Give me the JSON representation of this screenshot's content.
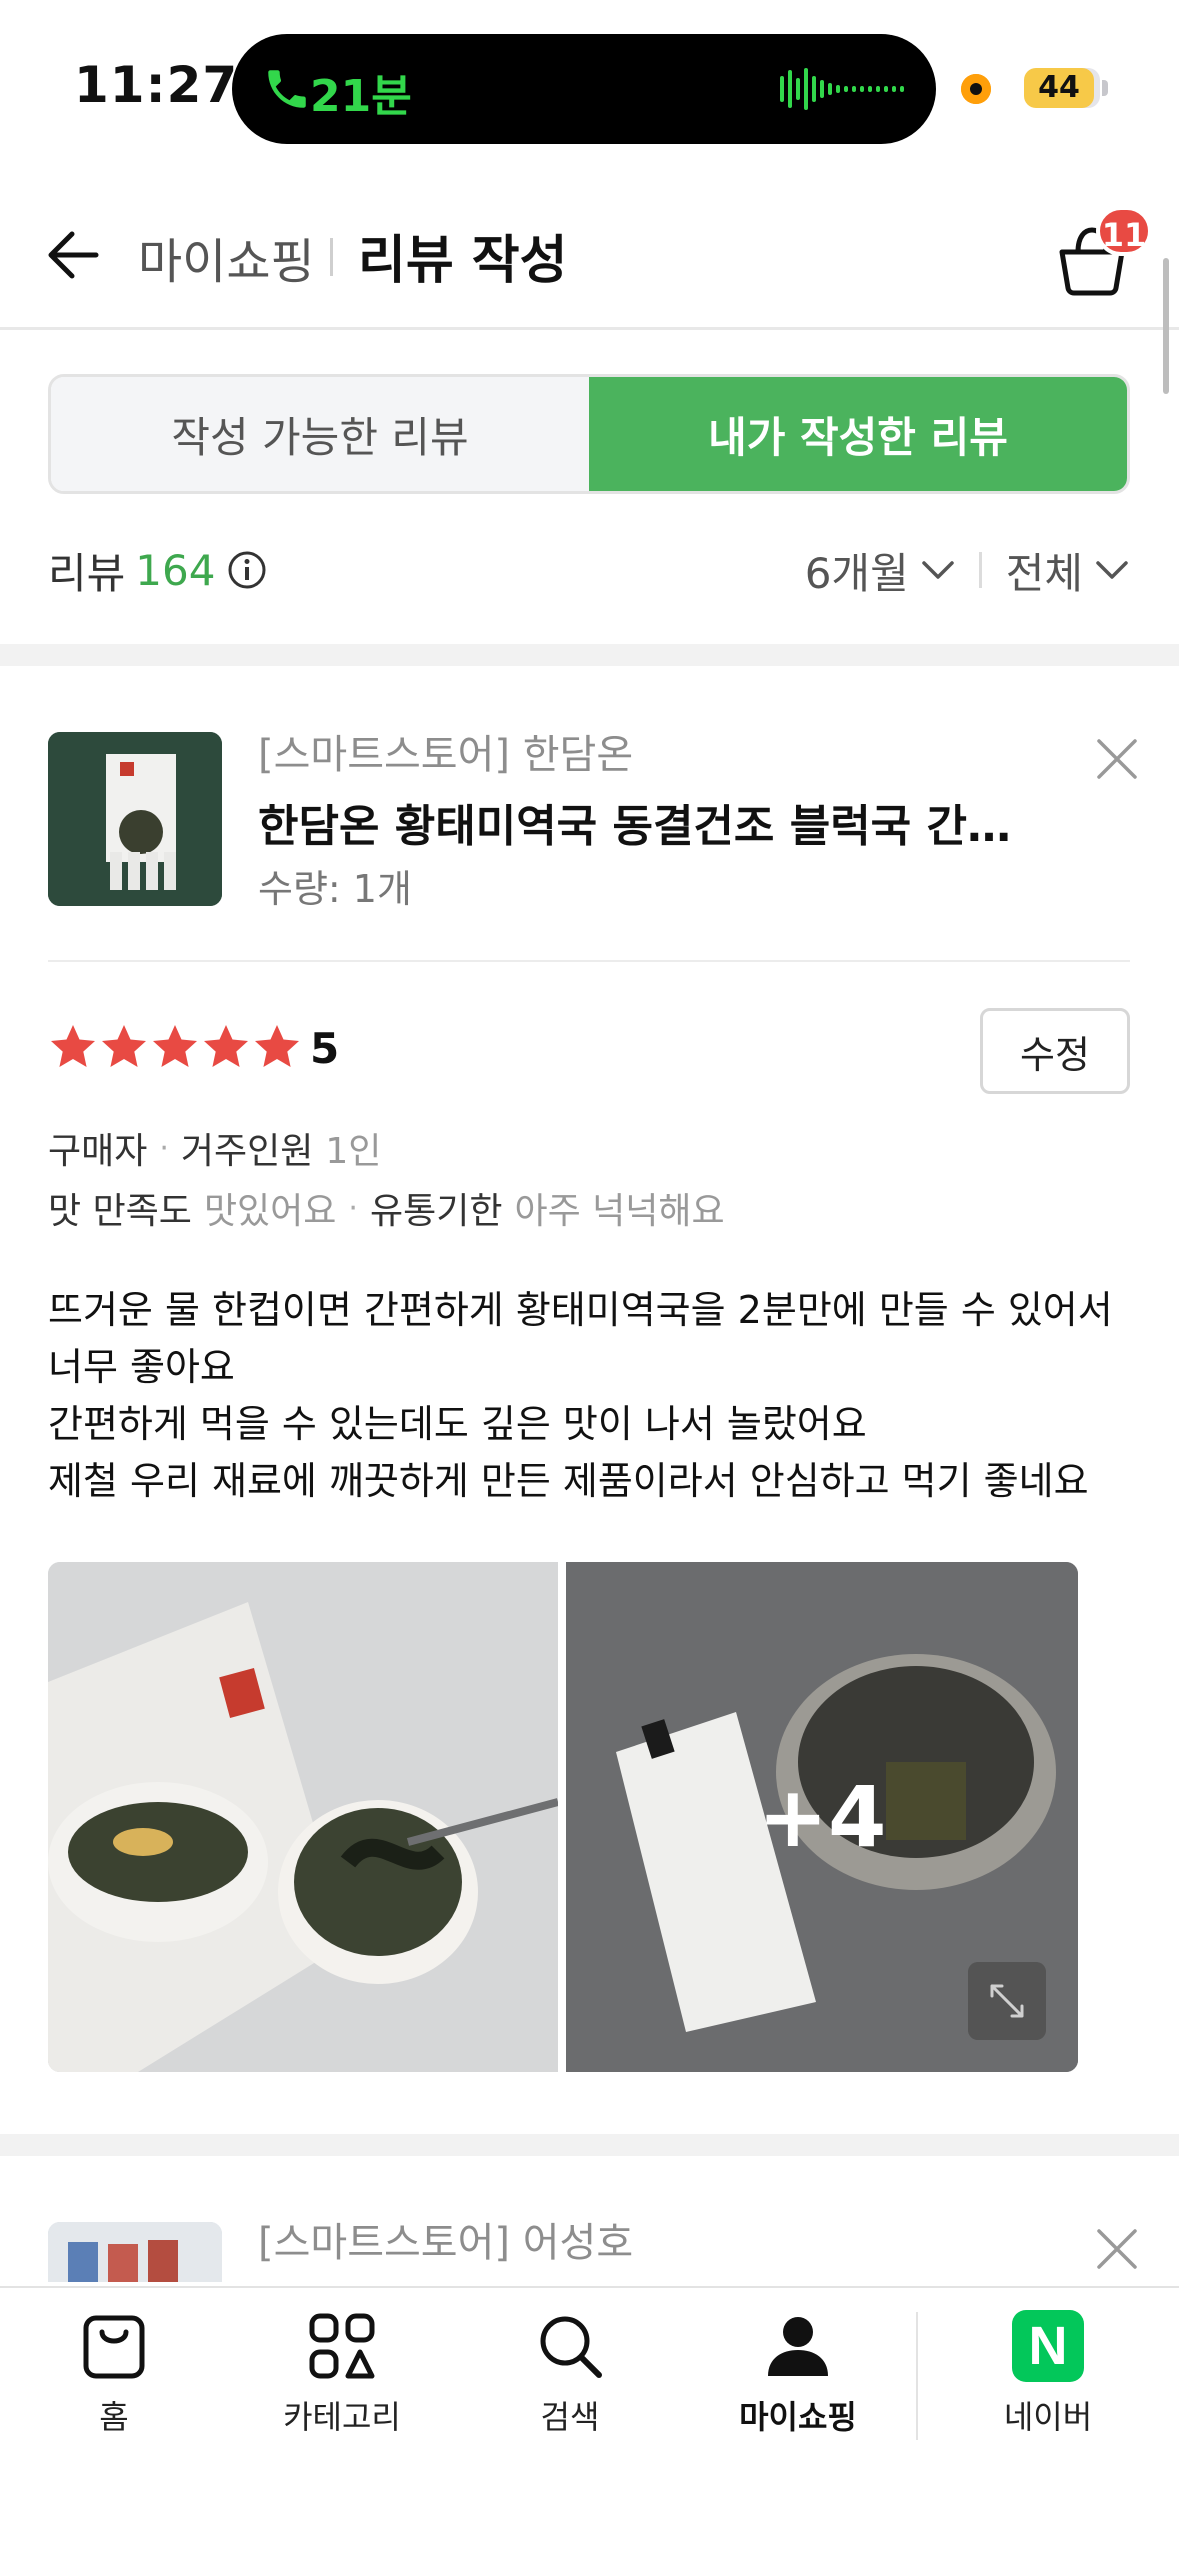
{
  "status_bar": {
    "time": "11:27",
    "call_duration": "21분",
    "battery": "44"
  },
  "header": {
    "parent": "마이쇼핑",
    "title": "리뷰 작성",
    "cart_count": "11"
  },
  "tabs": [
    {
      "label": "작성 가능한 리뷰",
      "active": false
    },
    {
      "label": "내가 작성한 리뷰",
      "active": true
    }
  ],
  "review_summary": {
    "label": "리뷰",
    "count": "164",
    "period_filter": "6개월",
    "type_filter": "전체"
  },
  "review": {
    "store": "[스마트스토어] 한담온",
    "product_name": "한담온 황태미역국 동결건조 블럭국 간편...",
    "quantity": "수량: 1개",
    "rating": "5",
    "edit_label": "수정",
    "meta1": {
      "buyer": "구매자",
      "household_key": "거주인원",
      "household_val": "1인"
    },
    "meta2": {
      "taste_key": "맛 만족도",
      "taste_val": "맛있어요",
      "expiry_key": "유통기한",
      "expiry_val": "아주 넉넉해요"
    },
    "text_lines": [
      "뜨거운 물 한컵이면 간편하게 황태미역국을 2분만에 만들 수 있어서",
      "너무 좋아요",
      "간편하게 먹을 수 있는데도 깊은 맛이 나서 놀랐어요",
      "제철 우리 재료에 깨끗하게 만든 제품이라서 안심하고 먹기 좋네요"
    ],
    "more_photos": "+4"
  },
  "next_review": {
    "store": "[스마트스토어] 어성호"
  },
  "bottom_nav": [
    {
      "label": "홈",
      "icon": "shopping-bag-icon",
      "active": false
    },
    {
      "label": "카테고리",
      "icon": "category-grid-icon",
      "active": false
    },
    {
      "label": "검색",
      "icon": "search-icon",
      "active": false
    },
    {
      "label": "마이쇼핑",
      "icon": "person-icon",
      "active": true
    },
    {
      "label": "네이버",
      "icon": "naver-logo-icon",
      "active": false
    }
  ],
  "colors": {
    "accent_green": "#4bb35d",
    "count_green": "#3ea84e",
    "star_red": "#e84a43",
    "badge_red": "#e84a43",
    "naver_green": "#03c75a"
  }
}
